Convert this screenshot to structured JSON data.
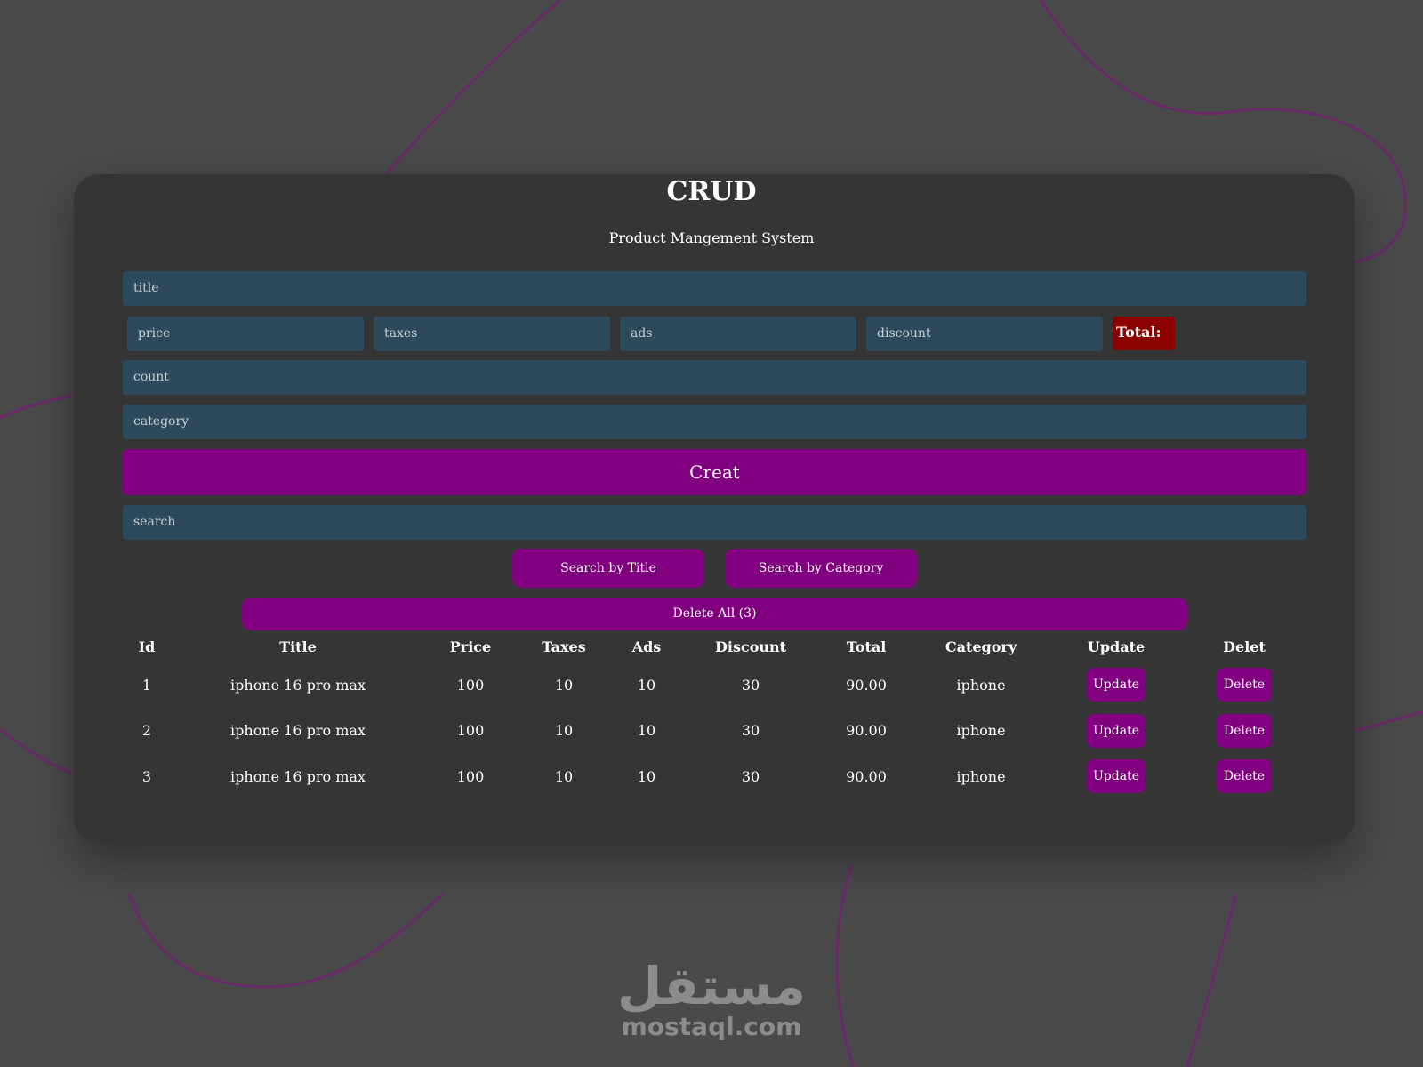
{
  "header": {
    "title": "CRUD",
    "subtitle": "Product Mangement System"
  },
  "form": {
    "title_placeholder": "title",
    "price_placeholder": "price",
    "taxes_placeholder": "taxes",
    "ads_placeholder": "ads",
    "discount_placeholder": "discount",
    "total_label": "Total:",
    "count_placeholder": "count",
    "category_placeholder": "category",
    "create_label": "Creat"
  },
  "search": {
    "placeholder": "search",
    "by_title_label": "Search by Title",
    "by_category_label": "Search by Category"
  },
  "delete_all_label": "Delete All (3)",
  "table": {
    "headers": [
      "Id",
      "Title",
      "Price",
      "Taxes",
      "Ads",
      "Discount",
      "Total",
      "Category",
      "Update",
      "Delet"
    ],
    "rows": [
      {
        "id": "1",
        "title": "iphone 16 pro max",
        "price": "100",
        "taxes": "10",
        "ads": "10",
        "discount": "30",
        "total": "90.00",
        "category": "iphone",
        "update": "Update",
        "delete": "Delete"
      },
      {
        "id": "2",
        "title": "iphone 16 pro max",
        "price": "100",
        "taxes": "10",
        "ads": "10",
        "discount": "30",
        "total": "90.00",
        "category": "iphone",
        "update": "Update",
        "delete": "Delete"
      },
      {
        "id": "3",
        "title": "iphone 16 pro max",
        "price": "100",
        "taxes": "10",
        "ads": "10",
        "discount": "30",
        "total": "90.00",
        "category": "iphone",
        "update": "Update",
        "delete": "Delete"
      }
    ]
  },
  "watermark": {
    "arabic": "مستقل",
    "latin": "mostaql.com"
  },
  "colors": {
    "accent": "#800080",
    "total_bg": "#8b0000",
    "input_bg": "#2d4a5c",
    "panel_bg": "#353535",
    "page_bg": "#4a4a4a"
  }
}
